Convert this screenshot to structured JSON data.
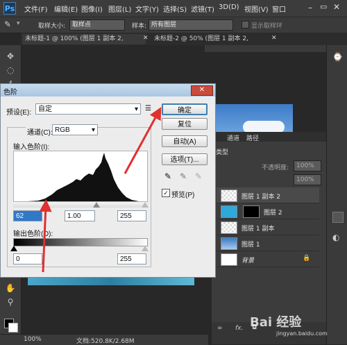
{
  "app": {
    "logo": "Ps"
  },
  "menu": [
    "文件(F)",
    "编辑(E)",
    "图像(I)",
    "图层(L)",
    "文字(Y)",
    "选择(S)",
    "滤镜(T)",
    "3D(D)",
    "视图(V)",
    "窗口"
  ],
  "options": {
    "sample_size_label": "取样大小:",
    "sample_size_value": "取样点",
    "sample_label": "样本:",
    "sample_value": "所有图层",
    "show_ring_label": "显示取样环"
  },
  "tabs": [
    {
      "label": "未标题-1 @ 100% (图层 1 副本 2, RGB/8) *"
    },
    {
      "label": "未标题-2 @ 50% (图层 1 副本 2, RGB/8) *"
    }
  ],
  "status": {
    "zoom": "100%",
    "doc": "文档:520.8K/2.68M"
  },
  "layers_panel": {
    "tabs": [
      "通道",
      "路径"
    ],
    "kind_label": "类型",
    "opacity_label": "不透明度:",
    "opacity_value": "100%",
    "fill_value": "100%",
    "layers": [
      {
        "name": "图层 1 副本 2",
        "selected": true
      },
      {
        "name": "图层 2",
        "selected": false
      },
      {
        "name": "图层 1 副本",
        "selected": false
      },
      {
        "name": "图层 1",
        "selected": false
      },
      {
        "name": "背景",
        "selected": false
      }
    ]
  },
  "dialog": {
    "title": "色阶",
    "preset_label": "预设(E):",
    "preset_value": "自定",
    "channel_label": "通道(C):",
    "channel_value": "RGB",
    "input_label": "输入色阶(I):",
    "input_black": "62",
    "input_gamma": "1.00",
    "input_white": "255",
    "output_label": "输出色阶(O):",
    "output_black": "0",
    "output_white": "255",
    "buttons": {
      "ok": "确定",
      "reset": "复位",
      "auto": "自动(A)",
      "options": "选项(T)..."
    },
    "preview_label": "预览(P)",
    "preview_checked": true
  },
  "watermark": {
    "text": "Bai 经验",
    "sub": "jingyan.baidu.com"
  },
  "colors": {
    "accent": "#e03030",
    "selected_layer": "#4a4a4a",
    "ok_focus": "#3c7fb1"
  }
}
